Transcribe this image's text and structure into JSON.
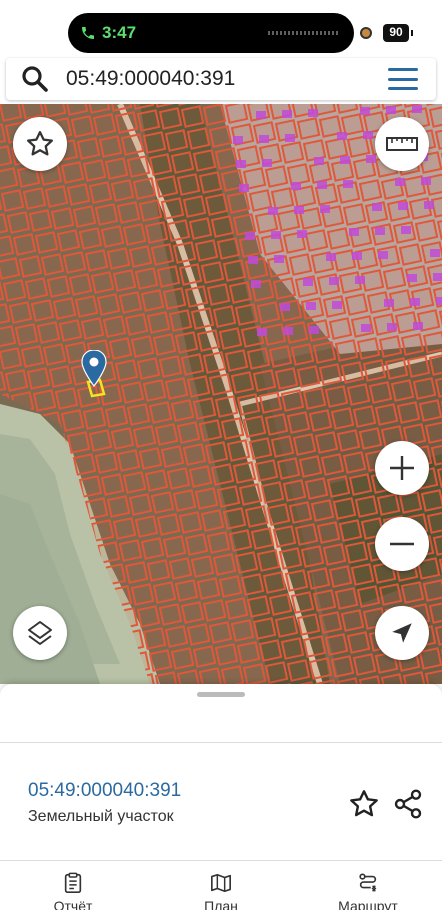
{
  "status_bar": {
    "time": "3:47",
    "battery": "90"
  },
  "search": {
    "value": "05:49:000040:391"
  },
  "map": {
    "selected_parcel_color": "#f2e51f",
    "parcel_outline_color": "#e0583a",
    "highlight_parcel_color": "#c04bd8",
    "marker_color": "#2b6aa0"
  },
  "parcel": {
    "number": "05:49:000040:391",
    "type": "Земельный участок"
  },
  "bottom_nav": [
    {
      "label": "Отчёт",
      "icon": "report-icon"
    },
    {
      "label": "План",
      "icon": "map-icon"
    },
    {
      "label": "Маршрут",
      "icon": "route-icon"
    }
  ]
}
